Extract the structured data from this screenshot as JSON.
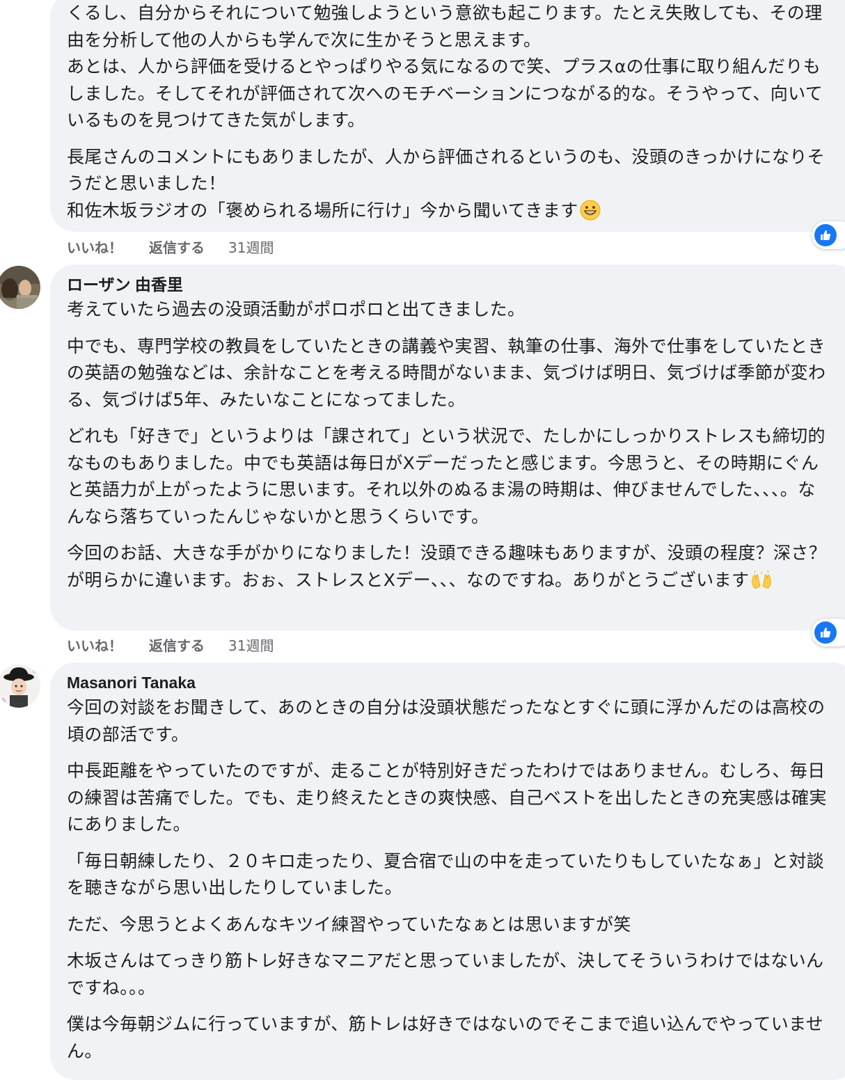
{
  "comments": [
    {
      "author": "",
      "paragraphs": [
        "くるし、自分からそれについて勉強しようという意欲も起こります。たとえ失敗しても、その理由を分析して他の人からも学んで次に生かそうと思えます。\nあとは、人から評価を受けるとやっぱりやる気になるので笑、プラスαの仕事に取り組んだりもしました。そしてそれが評価されて次へのモチベーションにつながる的な。そうやって、向いているものを見つけてきた気がします。",
        "長尾さんのコメントにもありましたが、人から評価されるというのも、没頭のきっかけになりそうだと思いました！\n和佐木坂ラジオの「褒められる場所に行け」今から聞いてきます"
      ],
      "trailing_emoji": "grinning-face",
      "actions": {
        "like": "いいね！",
        "reply": "返信する",
        "time": "31週間"
      }
    },
    {
      "author": "ローザン 由香里",
      "paragraphs": [
        "考えていたら過去の没頭活動がポロポロと出てきました。",
        "中でも、専門学校の教員をしていたときの講義や実習、執筆の仕事、海外で仕事をしていたときの英語の勉強などは、余計なことを考える時間がないまま、気づけば明日、気づけば季節が変わる、気づけば5年、みたいなことになってました。",
        "どれも「好きで」というよりは「課されて」という状況で、たしかにしっかりストレスも締切的なものもありました。中でも英語は毎日がXデーだったと感じます。今思うと、その時期にぐんと英語力が上がったように思います。それ以外のぬるま湯の時期は、伸びませんでした、、、。なんなら落ちていったんじゃないかと思うくらいです。",
        "今回のお話、大きな手がかりになりました！没頭できる趣味もありますが、没頭の程度？深さ？が明らかに違います。おぉ、ストレスとXデー、、、なのですね。ありがとうございます"
      ],
      "trailing_emoji": "raising-hands",
      "actions": {
        "like": "いいね！",
        "reply": "返信する",
        "time": "31週間"
      }
    },
    {
      "author": "Masanori Tanaka",
      "paragraphs": [
        "今回の対談をお聞きして、あのときの自分は没頭状態だったなとすぐに頭に浮かんだのは高校の頃の部活です。",
        "中長距離をやっていたのですが、走ることが特別好きだったわけではありません。むしろ、毎日の練習は苦痛でした。でも、走り終えたときの爽快感、自己ベストを出したときの充実感は確実にありました。",
        "「毎日朝練したり、２０キロ走ったり、夏合宿で山の中を走っていたりもしていたなぁ」と対談を聴きながら思い出したりしていました。",
        "ただ、今思うとよくあんなキツイ練習やっていたなぁとは思いますが笑",
        "木坂さんはてっきり筋トレ好きなマニアだと思っていましたが、決してそういうわけではないんですね。。。",
        "僕は今毎朝ジムに行っていますが、筋トレは好きではないのでそこまで追い込んでやっていません。"
      ]
    }
  ],
  "colors": {
    "bubble": "#f0f2f5",
    "text": "#1c1e21",
    "meta": "#65676b",
    "like_blue": "#1877f2"
  },
  "icons": [
    "like-reaction-icon",
    "avatar-yukari",
    "avatar-masanori"
  ]
}
